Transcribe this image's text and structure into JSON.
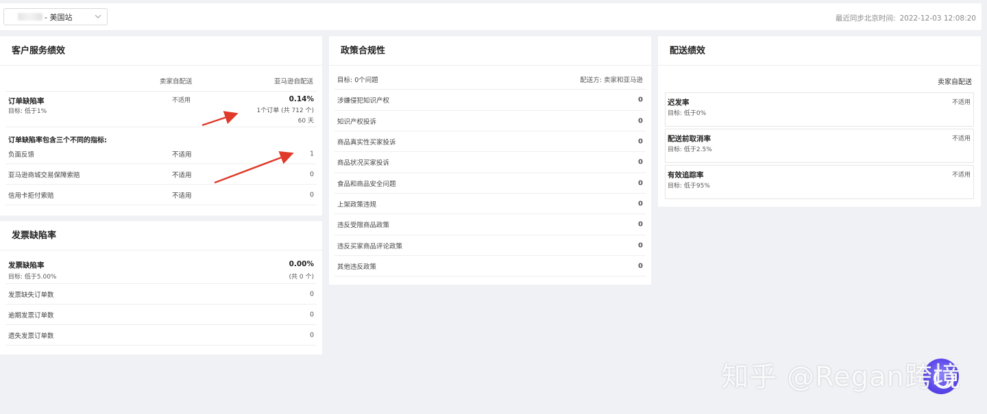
{
  "topbar": {
    "store": "- 美国站",
    "sync_label": "最近同步北京时间:",
    "sync_time": "2022-12-03 12:08:20"
  },
  "customer_service": {
    "title": "客户服务绩效",
    "col_seller": "卖家自配送",
    "col_amazon": "亚马逊自配送",
    "odr_label": "订单缺陷率",
    "odr_goal": "目标: 低于1%",
    "odr_seller": "不适用",
    "odr_value": "0.14%",
    "odr_orders": "1个订单 (共 712 个)",
    "odr_days": "60 天",
    "sub_heading": "订单缺陷率包含三个不同的指标:",
    "metrics": [
      {
        "label": "负面反馈",
        "seller": "不适用",
        "amazon": "1"
      },
      {
        "label": "亚马逊商城交易保障索赔",
        "seller": "不适用",
        "amazon": "0"
      },
      {
        "label": "信用卡拒付索赔",
        "seller": "不适用",
        "amazon": "0"
      }
    ]
  },
  "invoice": {
    "title": "发票缺陷率",
    "label": "发票缺陷率",
    "goal": "目标: 低于5.00%",
    "value": "0.00%",
    "count": "(共 0 个)",
    "rows": [
      {
        "label": "发票缺失订单数",
        "value": "0"
      },
      {
        "label": "逾期发票订单数",
        "value": "0"
      },
      {
        "label": "遗失发票订单数",
        "value": "0"
      }
    ]
  },
  "policy": {
    "title": "政策合规性",
    "goal": "目标: 0个问题",
    "shipper": "配送方: 卖家和亚马逊",
    "rows": [
      {
        "label": "涉嫌侵犯知识产权",
        "value": "0"
      },
      {
        "label": "知识产权投诉",
        "value": "0"
      },
      {
        "label": "商品真实性买家投诉",
        "value": "0"
      },
      {
        "label": "商品状况买家投诉",
        "value": "0"
      },
      {
        "label": "食品和商品安全问题",
        "value": "0"
      },
      {
        "label": "上架政策违规",
        "value": "0"
      },
      {
        "label": "违反受限商品政策",
        "value": "0"
      },
      {
        "label": "违反买家商品评论政策",
        "value": "0"
      },
      {
        "label": "其他违反政策",
        "value": "0"
      }
    ]
  },
  "delivery": {
    "title": "配送绩效",
    "col": "卖家自配送",
    "cards": [
      {
        "name": "迟发率",
        "goal": "目标: 低于0%",
        "value": "不适用"
      },
      {
        "name": "配送前取消率",
        "goal": "目标: 低于2.5%",
        "value": "不适用"
      },
      {
        "name": "有效追踪率",
        "goal": "目标: 低于95%",
        "value": "不适用"
      }
    ]
  },
  "watermark": "知乎 @Regan跨境",
  "colors": {
    "arrow": "#e03a2a",
    "logo": "#5a45e8"
  }
}
